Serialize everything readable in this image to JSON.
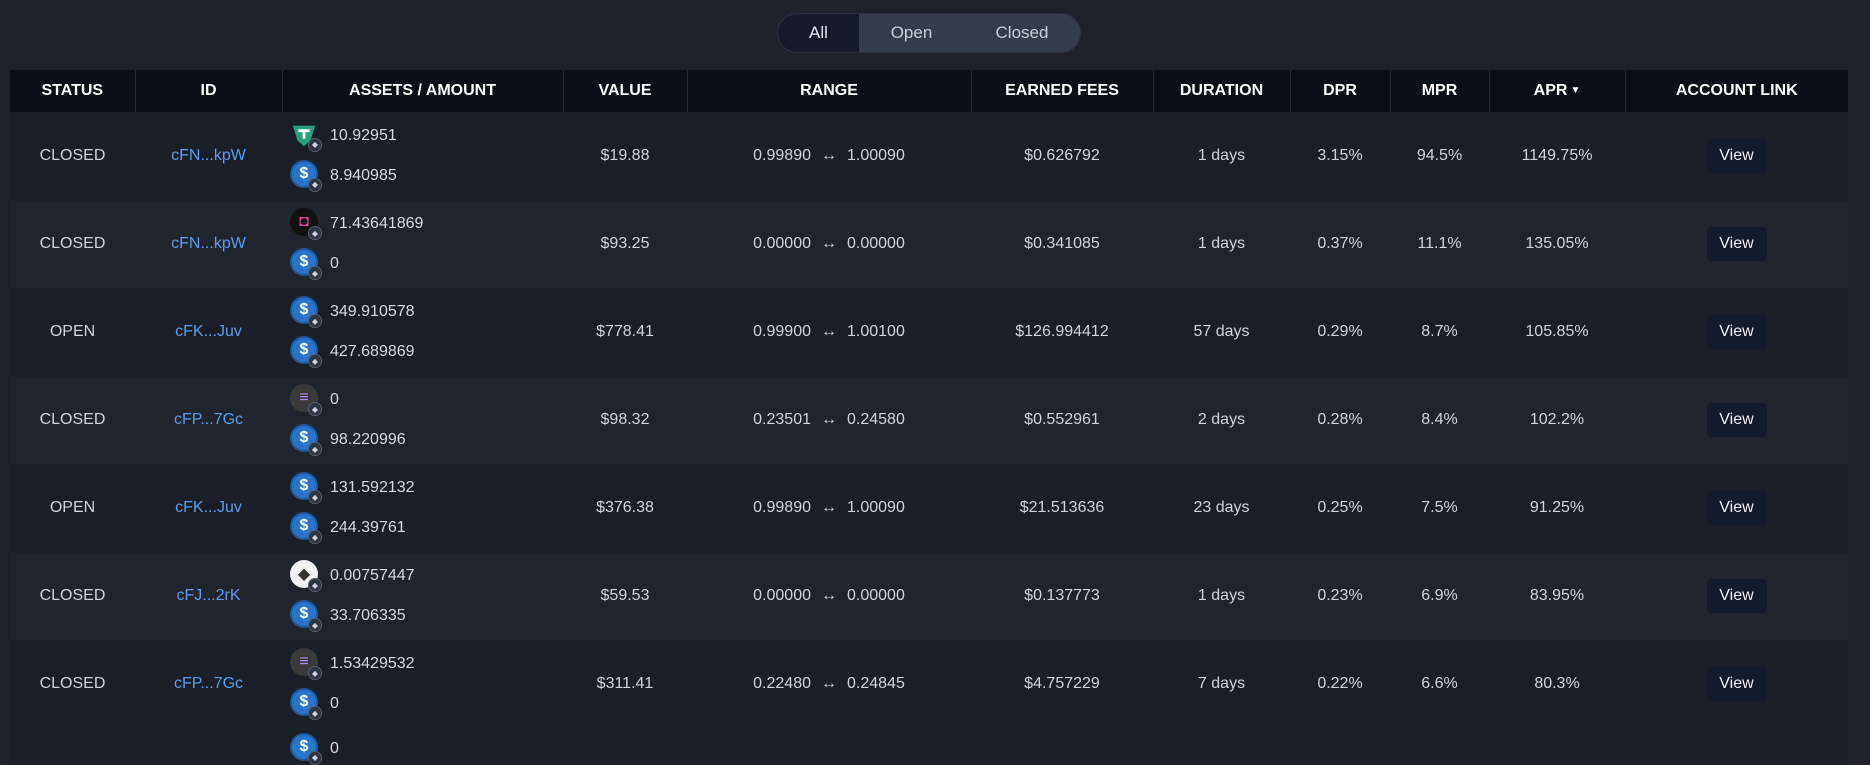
{
  "filters": {
    "all": "All",
    "open": "Open",
    "closed": "Closed",
    "active": "All"
  },
  "headers": {
    "status": "STATUS",
    "id": "ID",
    "assets": "ASSETS / AMOUNT",
    "value": "VALUE",
    "range": "RANGE",
    "fees": "EARNED FEES",
    "duration": "DURATION",
    "dpr": "DPR",
    "mpr": "MPR",
    "apr": "APR",
    "account": "ACCOUNT LINK"
  },
  "sort": {
    "column": "APR",
    "direction": "descending",
    "indicator": "▼"
  },
  "range_separator": "↔",
  "rows": [
    {
      "status": "CLOSED",
      "id": "cFN...kpW",
      "a1_icon": "usdt-icon",
      "a1": "10.92951",
      "a2_icon": "usdc-icon",
      "a2": "8.940985",
      "value": "$19.88",
      "r_low": "0.99890",
      "r_high": "1.00090",
      "fees": "$0.626792",
      "duration": "1 days",
      "dpr": "3.15%",
      "mpr": "94.5%",
      "apr": "1149.75%",
      "link": "View"
    },
    {
      "status": "CLOSED",
      "id": "cFN...kpW",
      "a1_icon": "generic-token-icon",
      "a1": "71.43641869",
      "a2_icon": "usdc-icon",
      "a2": "0",
      "value": "$93.25",
      "r_low": "0.00000",
      "r_high": "0.00000",
      "fees": "$0.341085",
      "duration": "1 days",
      "dpr": "0.37%",
      "mpr": "11.1%",
      "apr": "135.05%",
      "link": "View"
    },
    {
      "status": "OPEN",
      "id": "cFK...Juv",
      "a1_icon": "usdc-icon",
      "a1": "349.910578",
      "a2_icon": "usdc-icon",
      "a2": "427.689869",
      "value": "$778.41",
      "r_low": "0.99900",
      "r_high": "1.00100",
      "fees": "$126.994412",
      "duration": "57 days",
      "dpr": "0.29%",
      "mpr": "8.7%",
      "apr": "105.85%",
      "link": "View"
    },
    {
      "status": "CLOSED",
      "id": "cFP...7Gc",
      "a1_icon": "sol-icon",
      "a1": "0",
      "a2_icon": "usdc-icon",
      "a2": "98.220996",
      "value": "$98.32",
      "r_low": "0.23501",
      "r_high": "0.24580",
      "fees": "$0.552961",
      "duration": "2 days",
      "dpr": "0.28%",
      "mpr": "8.4%",
      "apr": "102.2%",
      "link": "View"
    },
    {
      "status": "OPEN",
      "id": "cFK...Juv",
      "a1_icon": "usdc-icon",
      "a1": "131.592132",
      "a2_icon": "usdc-icon",
      "a2": "244.39761",
      "value": "$376.38",
      "r_low": "0.99890",
      "r_high": "1.00090",
      "fees": "$21.513636",
      "duration": "23 days",
      "dpr": "0.25%",
      "mpr": "7.5%",
      "apr": "91.25%",
      "link": "View"
    },
    {
      "status": "CLOSED",
      "id": "cFJ...2rK",
      "a1_icon": "eth-icon",
      "a1": "0.00757447",
      "a2_icon": "usdc-icon",
      "a2": "33.706335",
      "value": "$59.53",
      "r_low": "0.00000",
      "r_high": "0.00000",
      "fees": "$0.137773",
      "duration": "1 days",
      "dpr": "0.23%",
      "mpr": "6.9%",
      "apr": "83.95%",
      "link": "View"
    },
    {
      "status": "CLOSED",
      "id": "cFP...7Gc",
      "a1_icon": "sol-icon",
      "a1": "1.53429532",
      "a2_icon": "usdc-icon",
      "a2": "0",
      "value": "$311.41",
      "r_low": "0.22480",
      "r_high": "0.24845",
      "fees": "$4.757229",
      "duration": "7 days",
      "dpr": "0.22%",
      "mpr": "6.6%",
      "apr": "80.3%",
      "link": "View"
    }
  ],
  "partial_row": {
    "a1_icon": "usdc-icon",
    "a1": "0"
  }
}
